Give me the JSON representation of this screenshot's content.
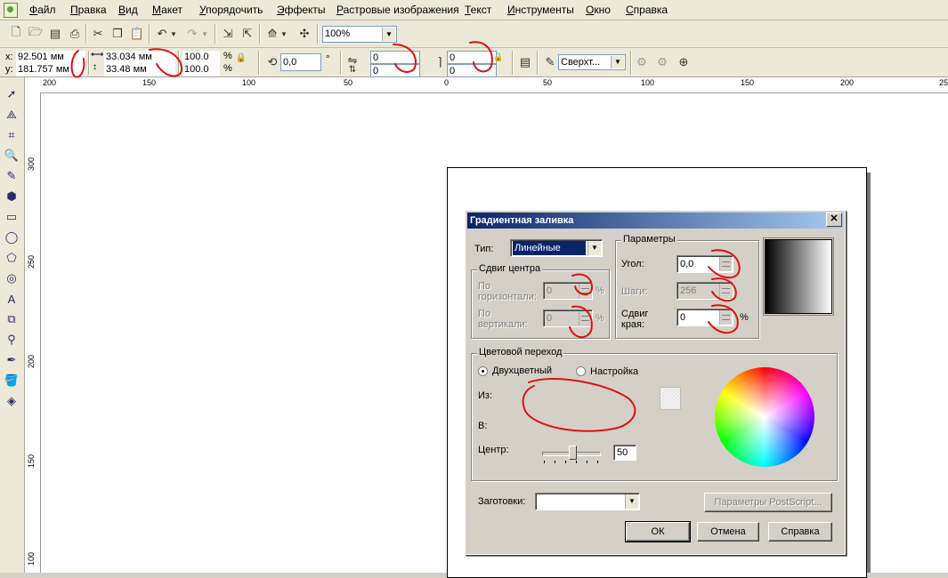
{
  "menu": [
    "Файл",
    "Правка",
    "Вид",
    "Макет",
    "Упорядочить",
    "Эффекты",
    "Растровые изображения",
    "Текст",
    "Инструменты",
    "Окно",
    "Справка"
  ],
  "toolbar": {
    "zoom": "100%"
  },
  "property_bar": {
    "x": "92.501 мм",
    "y": "181.757 мм",
    "x_label": "x:",
    "y_label": "y:",
    "width": "33.034 мм",
    "height": "33.48 мм",
    "scale_x": "100.0",
    "scale_y": "100.0",
    "percent": "%",
    "angle": "0,0",
    "degree": "°",
    "corner1": "0",
    "corner2": "0",
    "corner3": "0",
    "corner4": "0",
    "wrap": "Сверхт..."
  },
  "ruler_h": [
    "200",
    "150",
    "100",
    "50",
    "0",
    "50",
    "100",
    "150",
    "200",
    "25"
  ],
  "ruler_v": [
    "300",
    "250",
    "200",
    "150",
    "100"
  ],
  "dialog": {
    "title": "Градиентная заливка",
    "close": "✕",
    "type_label": "Тип:",
    "type_value": "Линейные",
    "center_group": "Сдвиг центра",
    "horiz_label_1": "По",
    "horiz_label_2": "горизонтали:",
    "horiz_value": "0",
    "vert_label_1": "По",
    "vert_label_2": "вертикали:",
    "vert_value": "0",
    "pct": "%",
    "params_group": "Параметры",
    "angle_label": "Угол:",
    "angle_value": "0,0",
    "steps_label": "Шаги:",
    "steps_value": "256",
    "edge_label_1": "Сдвиг",
    "edge_label_2": "края:",
    "edge_value": "0",
    "blend_group": "Цветовой переход",
    "two_color": "Двухцветный",
    "custom": "Настройка",
    "from_label": "Из:",
    "to_label": "В:",
    "center_label": "Центр:",
    "center_value": "50",
    "presets_label": "Заготовки:",
    "presets_value": "",
    "postscript_button": "Параметры PostScript...",
    "ok": "ОК",
    "cancel": "Отмена",
    "help": "Справка"
  }
}
